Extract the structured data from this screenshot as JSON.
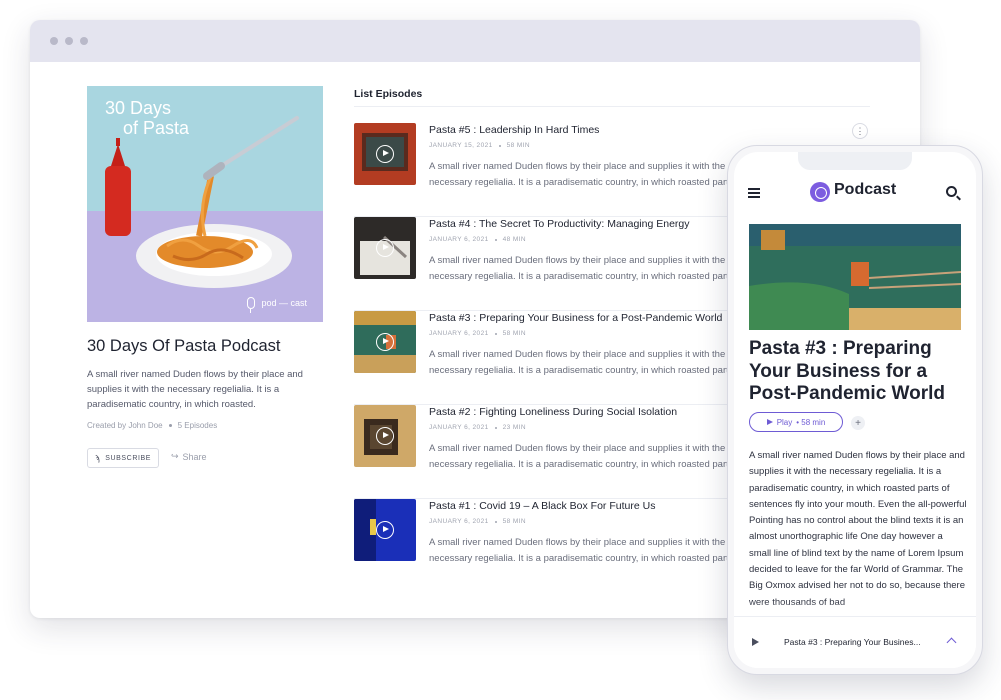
{
  "cover": {
    "title_line1": "30 Days",
    "title_line2": "of Pasta",
    "brand": "pod — cast"
  },
  "podcast": {
    "title": "30 Days Of Pasta Podcast",
    "description": "A small river named Duden flows by their place and supplies it with the necessary regelialia. It is a paradisematic country, in which roasted.",
    "creator": "Created by John Doe",
    "episode_count": "5 Episodes",
    "subscribe_label": "SUBSCRIBE",
    "share_label": "Share"
  },
  "episodes_list": {
    "heading": "List Episodes",
    "more_label": "⋮",
    "items": [
      {
        "title": "Pasta #5 : Leadership In Hard Times",
        "date": "JANUARY 15, 2021",
        "duration": "58 MIN",
        "excerpt": "A small river named Duden flows by their place and supplies it with the necessary regelialia. It is a paradisematic country, in which roasted parts of..."
      },
      {
        "title": "Pasta #4 : The Secret To Productivity: Managing Energy",
        "date": "JANUARY 6, 2021",
        "duration": "48 MIN",
        "excerpt": "A small river named Duden flows by their place and supplies it with the necessary regelialia. It is a paradisematic country, in which roasted parts of..."
      },
      {
        "title": "Pasta #3 : Preparing Your Business for a Post-Pandemic World",
        "date": "JANUARY 6, 2021",
        "duration": "58 MIN",
        "excerpt": "A small river named Duden flows by their place and supplies it with the necessary regelialia. It is a paradisematic country, in which roasted parts of..."
      },
      {
        "title": "Pasta #2 : Fighting Loneliness During Social Isolation",
        "date": "JANUARY 6, 2021",
        "duration": "23 MIN",
        "excerpt": "A small river named Duden flows by their place and supplies it with the necessary regelialia. It is a paradisematic country, in which roasted parts of..."
      },
      {
        "title": "Pasta #1 : Covid 19 – A Black Box For Future Us",
        "date": "JANUARY 6, 2021",
        "duration": "58 MIN",
        "excerpt": "A small river named Duden flows by their place and supplies it with the necessary regelialia. It is a paradisematic country, in which roasted parts of..."
      }
    ]
  },
  "phone": {
    "brand": "Podcast",
    "episode_title": "Pasta #3 : Preparing Your Business for a Post-Pandemic World",
    "play_label": "Play",
    "play_duration": "• 58 min",
    "add_label": "+",
    "body": "A small river named Duden flows by their place and supplies it with the necessary regelialia. It is a paradisematic country, in which roasted parts of sentences fly into your mouth. Even the all-powerful Pointing has no control about the blind texts it is an almost unorthographic life One day however a small line of blind text by the name of Lorem Ipsum decided to leave for the far World of Grammar. The Big Oxmox advised her not to do so, because there were thousands of bad",
    "mini_player_title": "Pasta #3 : Preparing Your Busines..."
  },
  "colors": {
    "accent": "#6e5bd4",
    "brand_logo": "#7c5ce0",
    "browser_bar": "#e4e4ef",
    "text_primary": "#1f2330",
    "text_muted": "#6a6e7c"
  },
  "icons": [
    "menu-icon",
    "search-icon",
    "play-icon",
    "rss-icon",
    "share-icon",
    "more-icon",
    "chevron-up-icon",
    "mic-icon"
  ]
}
